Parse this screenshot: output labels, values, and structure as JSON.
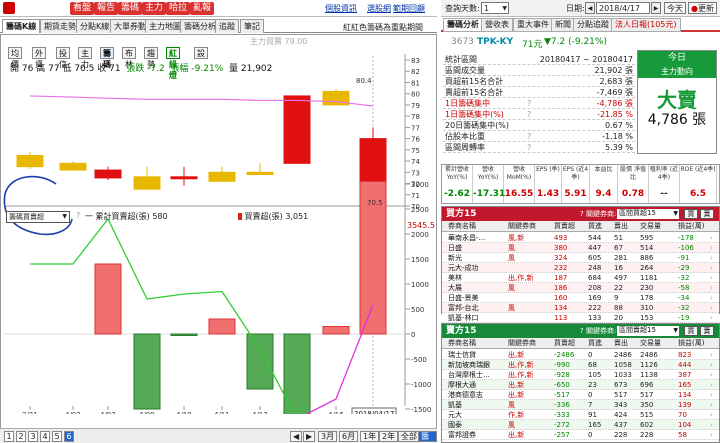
{
  "toolbar": {
    "buttons": [
      "看盤",
      "報告",
      "籌碼",
      "主力",
      "哈拉",
      "亂報"
    ],
    "links": [
      "個股資訊",
      "選股網",
      "範期回顧"
    ]
  },
  "left_tabs": [
    "籌碼K線",
    "期貨走勢",
    "分點K線",
    "大單券動",
    "主力地圖",
    "籌碼分析",
    "追蹤",
    "筆記"
  ],
  "notice": "紅紅色籌碼為重點期間",
  "watermark": "主力買賣 79.00",
  "chart_buttons": [
    "均價",
    "外資",
    "投信",
    "主力",
    "籌碼",
    "布林",
    "趨勢",
    "紅綠燈",
    "設"
  ],
  "ohlc": {
    "open_label": "開",
    "open": "76",
    "high_label": "高",
    "high": "77",
    "low_label": "低",
    "low": "70.5",
    "close_label": "收",
    "close": "71",
    "chg_label": "張跌",
    "chg": "-7.2",
    "pct_label": "張幅",
    "pct": "-9.21%",
    "vol_label": "量",
    "vol": "21,902"
  },
  "indicator_select": "籌碼買賣超",
  "legend": {
    "cum_label": "一 累計買賣超(張)",
    "cum_value": "580",
    "net_label": "買賣超(張)",
    "net_value": "3,051",
    "top_value": "3545.5"
  },
  "price_axis": [
    "83",
    "82",
    "81",
    "80",
    "79",
    "78",
    "77",
    "76",
    "75",
    "74",
    "73",
    "72",
    "71",
    "70"
  ],
  "price_marks": {
    "high_label": "80.4",
    "low_label": "70.5"
  },
  "lower_axis": [
    "3000",
    "2500",
    "2000",
    "1500",
    "1000",
    "500",
    "0",
    "-500",
    "-1000",
    "-1500",
    "-2000"
  ],
  "date_axis": [
    "3/31",
    "4/02",
    "4/03",
    "4/09",
    "4/10",
    "4/11",
    "4/12",
    "4/13",
    "4/16"
  ],
  "year_label": "2018",
  "date_tag": "2018/04/17",
  "pages": [
    "1",
    "2",
    "3",
    "4",
    "5",
    "6"
  ],
  "ranges": [
    "3月",
    "6月",
    "1年",
    "2年",
    "全部"
  ],
  "ranges_extra": "籌價",
  "chart_data": [
    {
      "type": "candlestick",
      "x": [
        "3/31",
        "4/02",
        "4/03",
        "4/09",
        "4/10",
        "4/11",
        "4/12",
        "4/13",
        "4/16",
        "4/17"
      ],
      "ohlc": [
        [
          74.5,
          74.8,
          73.3,
          73.5
        ],
        [
          73.8,
          74.0,
          73.2,
          73.2
        ],
        [
          72.5,
          73.5,
          72.3,
          73.2
        ],
        [
          72.6,
          73.5,
          71.5,
          71.5
        ],
        [
          72.5,
          73.5,
          71.8,
          72.6
        ],
        [
          73.0,
          73.5,
          72.2,
          72.2
        ],
        [
          73.0,
          73.8,
          72.8,
          72.8
        ],
        [
          73.8,
          79.8,
          73.8,
          79.8
        ],
        [
          80.2,
          80.4,
          79.0,
          79.0
        ],
        [
          76.0,
          77.0,
          70.5,
          71.0
        ]
      ],
      "ma": [
        79.8,
        79.7,
        79.6,
        79.5,
        79.5,
        79.5,
        79.4,
        79.4,
        79.3,
        78.9
      ],
      "ylim": [
        70,
        83
      ]
    },
    {
      "type": "bar",
      "categories": [
        "3/31",
        "4/02",
        "4/03",
        "4/09",
        "4/10",
        "4/11",
        "4/12",
        "4/13",
        "4/16",
        "4/17"
      ],
      "series": [
        {
          "name": "買賣超(張)",
          "values": [
            0,
            0,
            1400,
            -1500,
            -20,
            300,
            -1100,
            -1700,
            150,
            3051
          ]
        },
        {
          "name": "累計買賣超(張)",
          "values": [
            1400,
            1400,
            2300,
            700,
            800,
            850,
            -300,
            -1700,
            -1300,
            580
          ]
        }
      ],
      "ylim": [
        -2200,
        3545.5
      ]
    }
  ],
  "right": {
    "query_label": "查詢天數:",
    "query_days": "1",
    "date_label": "日期:",
    "date": "2018/4/17",
    "today_btn": "今天",
    "refresh_btn": "更新",
    "tabs": [
      "籌碼分析",
      "營收表",
      "重大事件",
      "新聞",
      "分點追蹤",
      "法人日報(105元)"
    ],
    "stock": {
      "code": "3673",
      "name": "TPK-KY",
      "price": "71元",
      "change": "▼7.2 (-9.21%)"
    },
    "summary": [
      {
        "k": "統計區間",
        "v": "20180417 ~ 20180417",
        "q": ""
      },
      {
        "k": "區間成交量",
        "v": "21,902 張",
        "q": ""
      },
      {
        "k": "買超前15名合計",
        "v": "2,683 張",
        "q": ""
      },
      {
        "k": "賣超前15名合計",
        "v": "-7,469 張",
        "q": ""
      },
      {
        "k": "1日籌碼集中",
        "v": "-4,786 張",
        "q": "?"
      },
      {
        "k": "1日籌碼集中(%)",
        "v": "-21.85 %",
        "q": "?"
      },
      {
        "k": "20日籌碼集中(%)",
        "v": "0.67 %",
        "q": ""
      },
      {
        "k": "佔股本比重",
        "v": "-1.18 %",
        "q": "?"
      },
      {
        "k": "區間周轉率",
        "v": "5.39 %",
        "q": "?"
      }
    ],
    "big": {
      "h1": "今日",
      "h2": "主力動向",
      "b1": "大賣",
      "b2": "4,786 張"
    },
    "fin": [
      {
        "h": "累計營收 YoY(%)",
        "v": "-2.62"
      },
      {
        "h": "營收 YoY(%)",
        "v": "-17.31"
      },
      {
        "h": "營收 MoM(%)",
        "v": "16.55"
      },
      {
        "h": "EPS (季)",
        "v": "1.43"
      },
      {
        "h": "EPS (近4季)",
        "v": "5.91"
      },
      {
        "h": "本益比",
        "v": "9.4"
      },
      {
        "h": "股價 淨值比",
        "v": "0.78"
      },
      {
        "h": "殖利率 (近4季)",
        "v": "--"
      },
      {
        "h": "ROE (近4季)",
        "v": "6.5"
      }
    ],
    "buy": {
      "title": "買方15",
      "rule": "? 關鍵券商:",
      "select": "區間買超15",
      "b1": "買",
      "b2": "賣",
      "cols": [
        "券商名稱",
        "關鍵券商",
        "買賣超",
        "買進",
        "賣出",
        "交易量",
        "損益(萬)"
      ],
      "rows": [
        [
          "華南永昌-...",
          "風,新",
          "493",
          "544",
          "51",
          "595",
          "-178"
        ],
        [
          "日盛",
          "風",
          "380",
          "447",
          "67",
          "514",
          "-106"
        ],
        [
          "新光",
          "風",
          "324",
          "605",
          "281",
          "886",
          "-91"
        ],
        [
          "元大-成功",
          "",
          "232",
          "248",
          "16",
          "264",
          "-29"
        ],
        [
          "美林",
          "出,作,新",
          "187",
          "684",
          "497",
          "1181",
          "-32"
        ],
        [
          "大展",
          "風",
          "186",
          "208",
          "22",
          "230",
          "-58"
        ],
        [
          "日盛-景美",
          "",
          "160",
          "169",
          "9",
          "178",
          "-34"
        ],
        [
          "富邦-台北",
          "風",
          "134",
          "222",
          "88",
          "310",
          "-32"
        ],
        [
          "凱基-林口",
          "",
          "113",
          "133",
          "20",
          "153",
          "-19"
        ]
      ]
    },
    "sell": {
      "title": "賣方15",
      "rule": "? 關鍵券商:",
      "select": "區間賣超15",
      "b1": "買",
      "b2": "賣",
      "cols": [
        "券商名稱",
        "關鍵券商",
        "買賣超",
        "買進",
        "賣出",
        "交易量",
        "損益(萬)"
      ],
      "rows": [
        [
          "瑞士信貸",
          "出,新",
          "-2486",
          "0",
          "2486",
          "2486",
          "823"
        ],
        [
          "新加坡商瑞銀",
          "出,作,新",
          "-990",
          "68",
          "1058",
          "1126",
          "444"
        ],
        [
          "台灣摩根士...",
          "出,作,新",
          "-928",
          "105",
          "1033",
          "1138",
          "387"
        ],
        [
          "摩根大通",
          "出,新",
          "-650",
          "23",
          "673",
          "696",
          "165"
        ],
        [
          "港商德意志",
          "出,新",
          "-517",
          "0",
          "517",
          "517",
          "134"
        ],
        [
          "凱基",
          "風",
          "-336",
          "7",
          "343",
          "350",
          "139"
        ],
        [
          "元大",
          "作,新",
          "-333",
          "91",
          "424",
          "515",
          "70"
        ],
        [
          "國泰",
          "風",
          "-272",
          "165",
          "437",
          "602",
          "104"
        ],
        [
          "富邦證券",
          "出,新",
          "-257",
          "0",
          "228",
          "228",
          "58"
        ]
      ]
    }
  }
}
